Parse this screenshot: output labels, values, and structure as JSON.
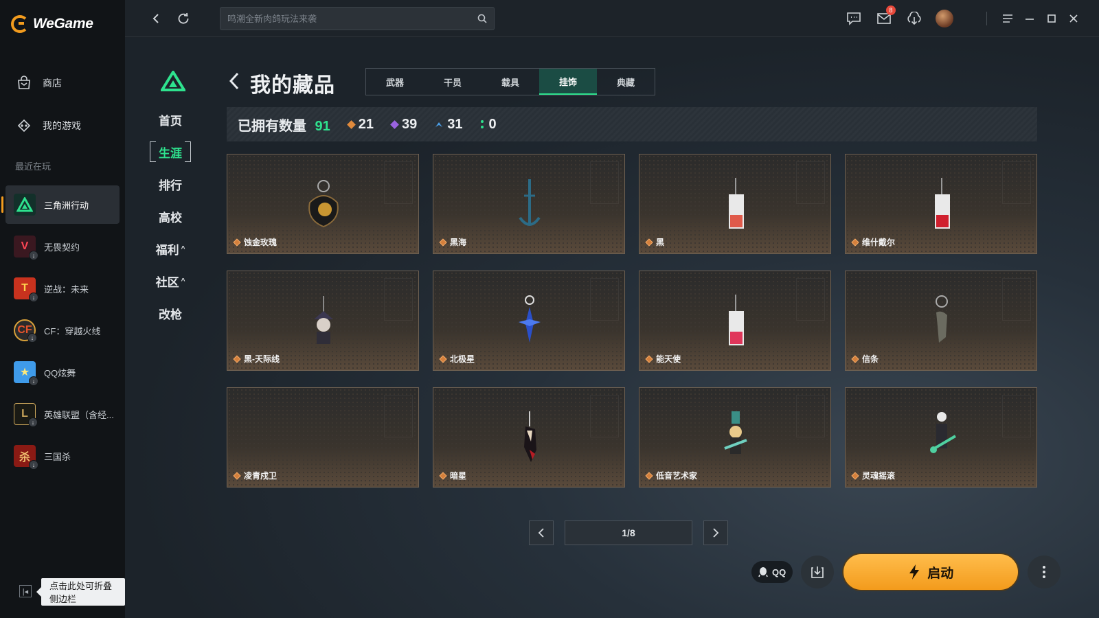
{
  "app": {
    "name": "WeGame"
  },
  "sidebar": {
    "nav": [
      {
        "label": "商店",
        "icon": "store-icon"
      },
      {
        "label": "我的游戏",
        "icon": "gamepad-icon"
      }
    ],
    "recent_label": "最近在玩",
    "games": [
      {
        "label": "三角洲行动",
        "active": true
      },
      {
        "label": "无畏契约",
        "active": false
      },
      {
        "label": "逆战：未来",
        "active": false
      },
      {
        "label": "CF：穿越火线",
        "active": false
      },
      {
        "label": "QQ炫舞",
        "active": false
      },
      {
        "label": "英雄联盟（含经...",
        "active": false
      },
      {
        "label": "三国杀",
        "active": false
      }
    ],
    "collapse_tooltip": "点击此处可折叠侧边栏"
  },
  "topbar": {
    "search_placeholder": "鸣潮全新肉鸽玩法来袭",
    "mail_badge": "8"
  },
  "subnav": [
    {
      "label": "首页",
      "active": false,
      "caret": ""
    },
    {
      "label": "生涯",
      "active": true,
      "caret": ""
    },
    {
      "label": "排行",
      "active": false,
      "caret": ""
    },
    {
      "label": "高校",
      "active": false,
      "caret": ""
    },
    {
      "label": "福利",
      "active": false,
      "caret": "^"
    },
    {
      "label": "社区",
      "active": false,
      "caret": "^"
    },
    {
      "label": "改枪",
      "active": false,
      "caret": ""
    }
  ],
  "page": {
    "title": "我的藏品",
    "tabs": [
      {
        "label": "武器",
        "active": false
      },
      {
        "label": "干员",
        "active": false
      },
      {
        "label": "载具",
        "active": false
      },
      {
        "label": "挂饰",
        "active": true
      },
      {
        "label": "典藏",
        "active": false
      }
    ],
    "stats": {
      "owned_label": "已拥有数量",
      "owned_total": "91",
      "quality_counts": [
        {
          "value": "21",
          "color": "#e08a3c"
        },
        {
          "value": "39",
          "color": "#9a63e0"
        },
        {
          "value": "31",
          "color": "#4a9fe8"
        },
        {
          "value": "0",
          "color": "#2ee28e"
        }
      ]
    },
    "items": [
      {
        "name": "蚀金玫瑰",
        "art": "golden-rose-charm"
      },
      {
        "name": "黑海",
        "art": "anchor-charm"
      },
      {
        "name": "黑",
        "art": "card-tag-charm"
      },
      {
        "name": "维什戴尔",
        "art": "card-tag-charm"
      },
      {
        "name": "黑-天际线",
        "art": "figure-charm"
      },
      {
        "name": "北极星",
        "art": "star-charm"
      },
      {
        "name": "能天使",
        "art": "card-tag-charm"
      },
      {
        "name": "信条",
        "art": "eagle-charm"
      },
      {
        "name": "凌青戍卫",
        "art": "empty"
      },
      {
        "name": "暗星",
        "art": "dark-star-charm"
      },
      {
        "name": "低音艺术家",
        "art": "guitarist-charm"
      },
      {
        "name": "灵魂摇滚",
        "art": "skeleton-guitar-charm"
      }
    ],
    "pagination": {
      "current": 1,
      "total": 8,
      "label": "1/8"
    }
  },
  "launcher": {
    "qq_label": "QQ",
    "launch_label": "启动"
  }
}
